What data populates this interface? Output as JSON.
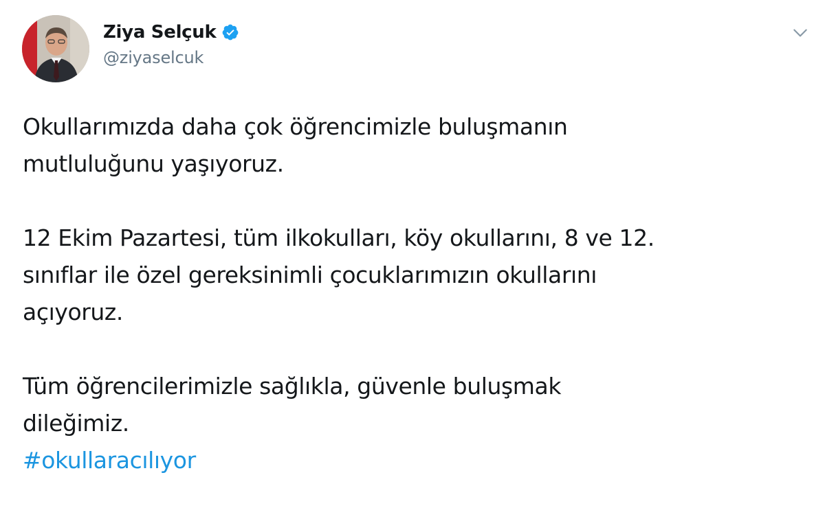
{
  "author": {
    "display_name": "Ziya Selçuk",
    "handle": "@ziyaselcuk",
    "verified": true
  },
  "icons": {
    "verified": "verified-badge-icon",
    "menu": "chevron-down-icon"
  },
  "tweet": {
    "paragraph1": [
      "Okullarımızda daha çok öğrencimizle buluşmanın",
      "mutluluğunu yaşıyoruz."
    ],
    "paragraph2": [
      "12 Ekim Pazartesi, tüm ilkokulları, köy okullarını, 8 ve 12.",
      "sınıflar ile özel gereksinimli çocuklarımızın okullarını",
      "açıyoruz."
    ],
    "paragraph3": [
      "Tüm öğrencilerimizle sağlıkla, güvenle buluşmak",
      "dileğimiz."
    ],
    "hashtag": "#okullaracılıyor"
  },
  "colors": {
    "text": "#14171a",
    "secondary": "#657786",
    "link": "#1b95e0",
    "verified": "#1da1f2"
  }
}
